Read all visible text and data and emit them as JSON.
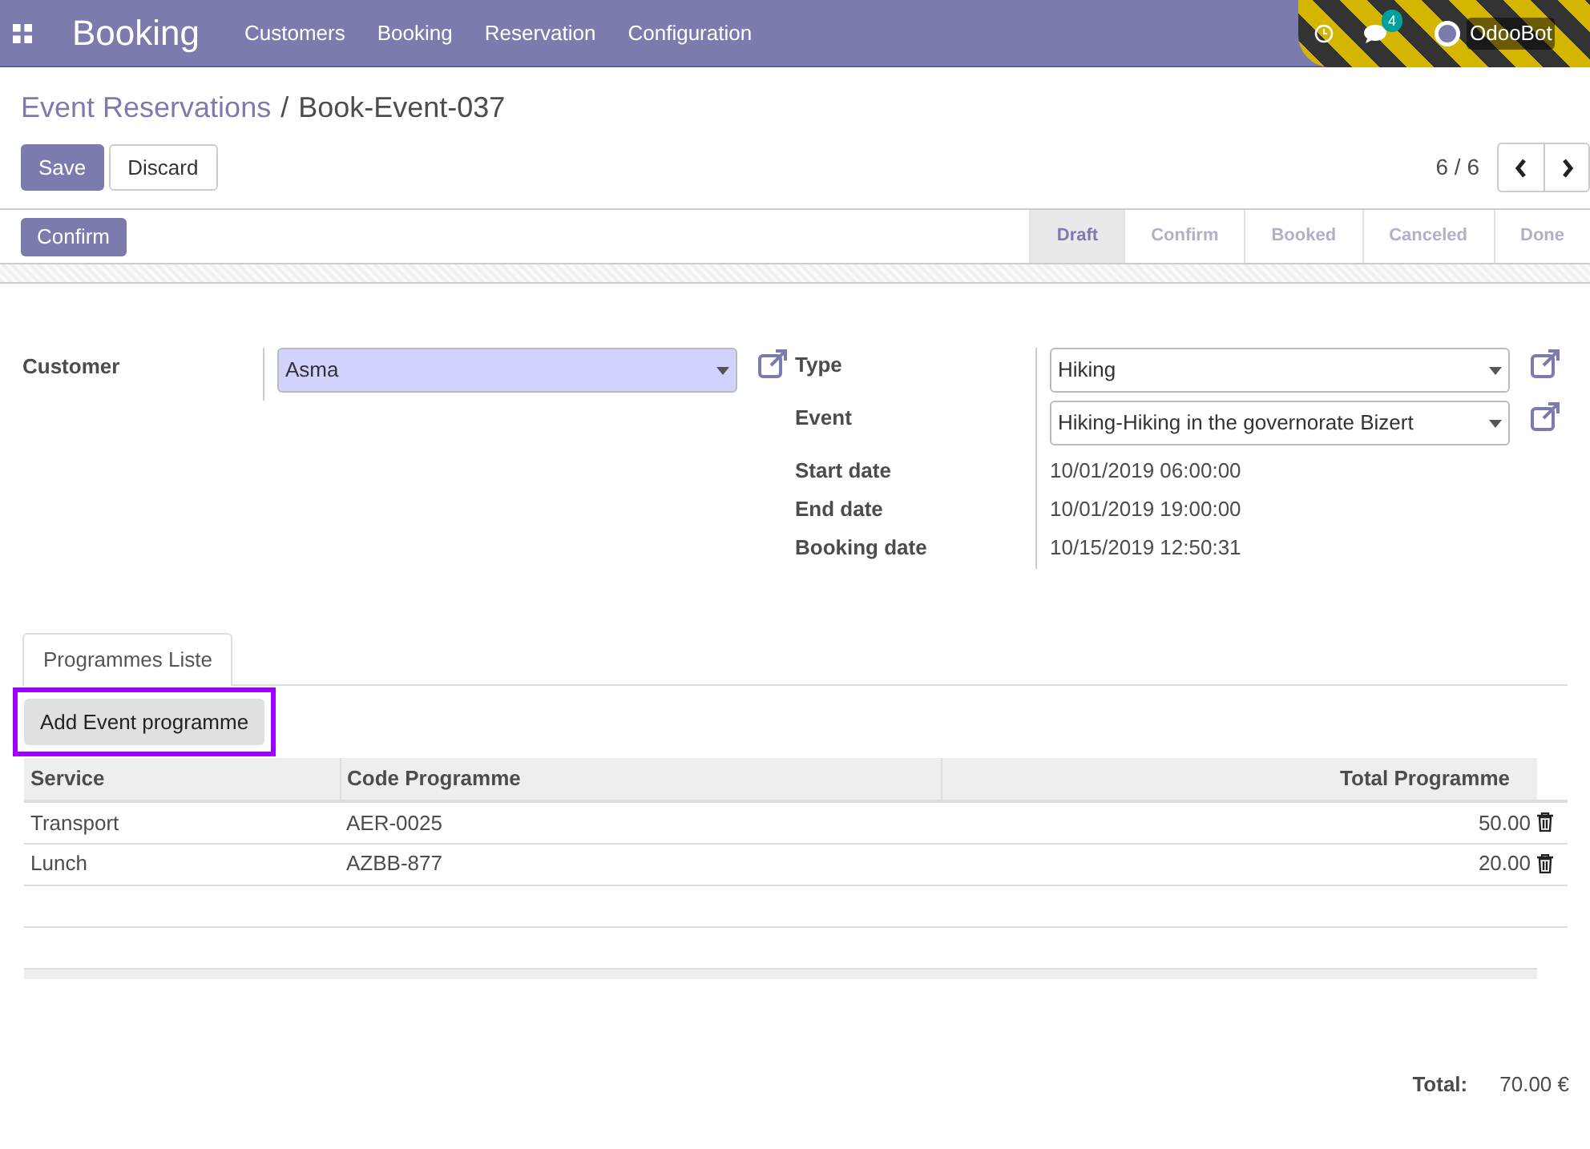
{
  "navbar": {
    "app_name": "Booking",
    "menu": [
      "Customers",
      "Booking",
      "Reservation",
      "Configuration"
    ],
    "message_count": "4",
    "user": "OdooBot"
  },
  "breadcrumb": {
    "parent": "Event Reservations",
    "separator": "/",
    "current": "Book-Event-037"
  },
  "buttons": [
    "Save",
    "Discard"
  ],
  "pager": "6 / 6",
  "header": {
    "action": "Confirm",
    "stages": [
      {
        "label": "Draft",
        "selected": true
      },
      {
        "label": "Confirm",
        "selected": false
      },
      {
        "label": "Booked",
        "selected": false
      },
      {
        "label": "Canceled",
        "selected": false
      },
      {
        "label": "Done",
        "selected": false
      }
    ]
  },
  "left_fields": [
    {
      "label": "Customer",
      "kind": "select",
      "value": "Asma",
      "highlighted": true
    }
  ],
  "right_fields": [
    {
      "label": "Type",
      "kind": "select",
      "value": "Hiking",
      "highlighted": false
    },
    {
      "label": "Event",
      "kind": "select",
      "value": "Hiking-Hiking in the governorate Bizert",
      "highlighted": false
    },
    {
      "label": "Start date",
      "kind": "text",
      "value": "10/01/2019 06:00:00"
    },
    {
      "label": "End date",
      "kind": "text",
      "value": "10/01/2019 19:00:00"
    },
    {
      "label": "Booking date",
      "kind": "text",
      "value": "10/15/2019 12:50:31"
    }
  ],
  "tabs": [
    {
      "label": "Programmes Liste",
      "selected": true
    }
  ],
  "add_button": {
    "label": "Add Event programme",
    "outlined": true
  },
  "table": {
    "columns": [
      "Service",
      "Code Programme",
      "Total Programme"
    ],
    "rows": [
      {
        "service": "Transport",
        "code": "AER-0025",
        "total": "50.00"
      },
      {
        "service": "Lunch",
        "code": "AZBB-877",
        "total": "20.00"
      }
    ]
  },
  "total": {
    "label": "Total:",
    "value": "70.00 €"
  }
}
